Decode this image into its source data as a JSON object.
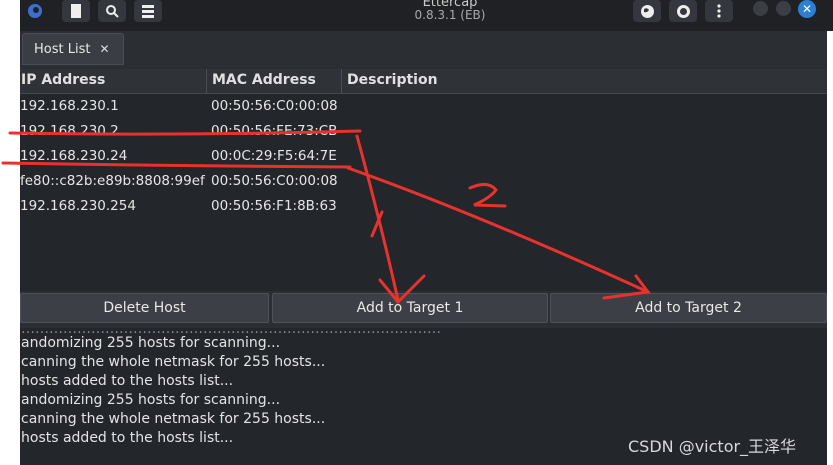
{
  "window": {
    "title": "Ettercap",
    "subtitle": "0.8.3.1 (EB)"
  },
  "icons": {
    "app": "ettercap-logo-icon",
    "file": "file-icon",
    "search": "search-icon",
    "hosts": "hosts-list-icon",
    "globe": "globe-icon",
    "record": "record-icon",
    "menu": "more-vertical-icon",
    "close": "close-icon"
  },
  "tab": {
    "label": "Host List",
    "close_glyph": "✕"
  },
  "table": {
    "columns": [
      "IP Address",
      "MAC Address",
      "Description"
    ],
    "rows": [
      {
        "ip": "192.168.230.1",
        "mac": "00:50:56:C0:00:08",
        "desc": ""
      },
      {
        "ip": "192.168.230.2",
        "mac": "00:50:56:FE:73:CB",
        "desc": ""
      },
      {
        "ip": "192.168.230.24",
        "mac": "00:0C:29:F5:64:7E",
        "desc": ""
      },
      {
        "ip": "fe80::c82b:e89b:8808:99ef",
        "mac": "00:50:56:C0:00:08",
        "desc": ""
      },
      {
        "ip": "192.168.230.254",
        "mac": "00:50:56:F1:8B:63",
        "desc": ""
      }
    ]
  },
  "buttons": {
    "delete": "Delete Host",
    "target1": "Add to Target 1",
    "target2": "Add to Target 2"
  },
  "log": {
    "lines": [
      "andomizing 255 hosts for scanning...",
      "canning the whole netmask for 255 hosts...",
      " hosts added to the hosts list...",
      "andomizing 255 hosts for scanning...",
      "canning the whole netmask for 255 hosts...",
      " hosts added to the hosts list..."
    ]
  },
  "annotations": {
    "label1": "1",
    "label2": "2",
    "color": "#e8322d"
  },
  "watermark": "CSDN @victor_王泽华"
}
